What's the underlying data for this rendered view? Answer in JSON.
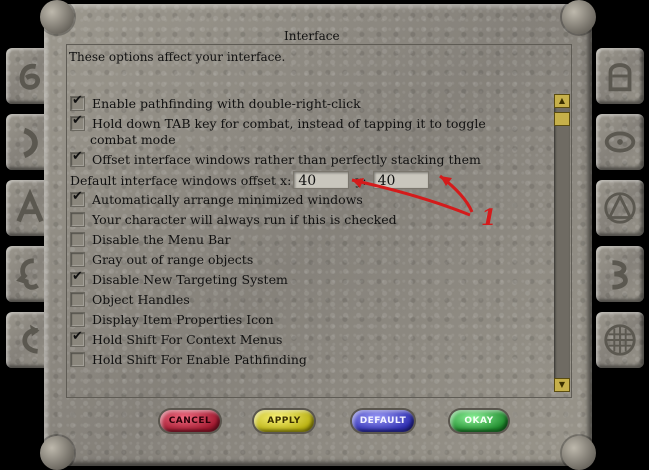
{
  "dialog": {
    "title": "Interface",
    "subtitle": "These options affect your interface."
  },
  "options": [
    {
      "label": "Enable pathfinding with double-right-click",
      "checked": true
    },
    {
      "label": "Hold down TAB key for combat, instead of tapping it to toggle",
      "label_line2": "combat mode",
      "checked": true
    },
    {
      "label": "Offset interface windows rather than perfectly stacking them",
      "checked": true
    },
    {
      "label": "Automatically arrange minimized windows",
      "checked": true
    },
    {
      "label": "Your character will always run if this is checked",
      "checked": false
    },
    {
      "label": "Disable the Menu Bar",
      "checked": false
    },
    {
      "label": "Gray out of range objects",
      "checked": false
    },
    {
      "label": "Disable New Targeting System",
      "checked": true
    },
    {
      "label": "Object Handles",
      "checked": false
    },
    {
      "label": "Display Item Properties Icon",
      "checked": false
    },
    {
      "label": "Hold Shift For Context Menus",
      "checked": true
    },
    {
      "label": "Hold Shift For Enable Pathfinding",
      "checked": false
    }
  ],
  "offset": {
    "label": "Default interface windows offset",
    "x_label": "x:",
    "x_value": "40",
    "y_label": "y:",
    "y_value": "40"
  },
  "buttons": {
    "cancel": "CANCEL",
    "apply": "APPLY",
    "default": "DEFAULT",
    "okay": "OKAY"
  },
  "annotation": {
    "number": "1",
    "color": "#d41b1b"
  },
  "side_tabs_left": [
    "tab-icon-6",
    "tab-icon-crescent",
    "tab-icon-a-glyph",
    "tab-icon-face",
    "tab-icon-arrow"
  ],
  "side_tabs_right": [
    "tab-icon-helmet",
    "tab-icon-eye",
    "tab-icon-triangle",
    "tab-icon-scroll",
    "tab-icon-grid"
  ],
  "colors": {
    "stone": "#8e8a80",
    "cancel_gem": "#b0203a",
    "apply_gem": "#d8d020",
    "default_gem": "#4a4ad0",
    "okay_gem": "#30b040",
    "scroll_gold": "#c6b04a"
  }
}
